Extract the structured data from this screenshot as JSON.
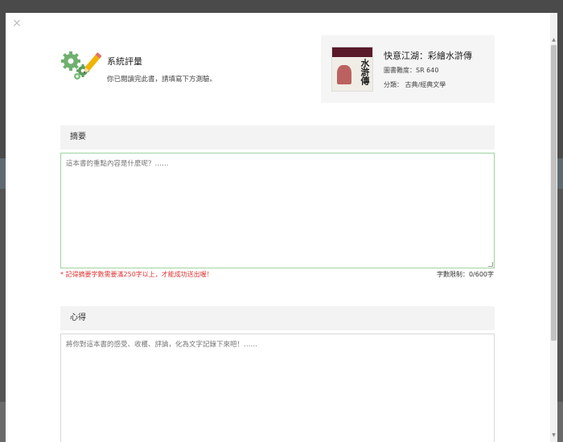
{
  "modal": {
    "close_glyph": "×",
    "evaluation": {
      "title": "系統評量",
      "subtitle": "你已閱讀完此書，請填寫下方測驗。",
      "icon": "gears-pencil-icon"
    },
    "book": {
      "title": "快意江湖：彩繪水滸傳",
      "level_label": "圖書難度：",
      "level_value": "SR 640",
      "category_label": "分類：",
      "category_value": "古典/經典文學",
      "cover_text": "水滸傳"
    },
    "summary": {
      "section_label": "摘要",
      "placeholder": "這本書的重點內容是什麼呢？……",
      "warning": "* 記得摘要字數需要滿250字以上，才能成功送出喔！",
      "limit_label": "字數限制：",
      "limit_value": "0/600字"
    },
    "reflection": {
      "section_label": "心得",
      "placeholder": "將你對這本書的感受、收穫、評論，化為文字記錄下來吧！……"
    }
  },
  "colors": {
    "accent_border": "#9ed39e",
    "warning_text": "#dd3333"
  }
}
